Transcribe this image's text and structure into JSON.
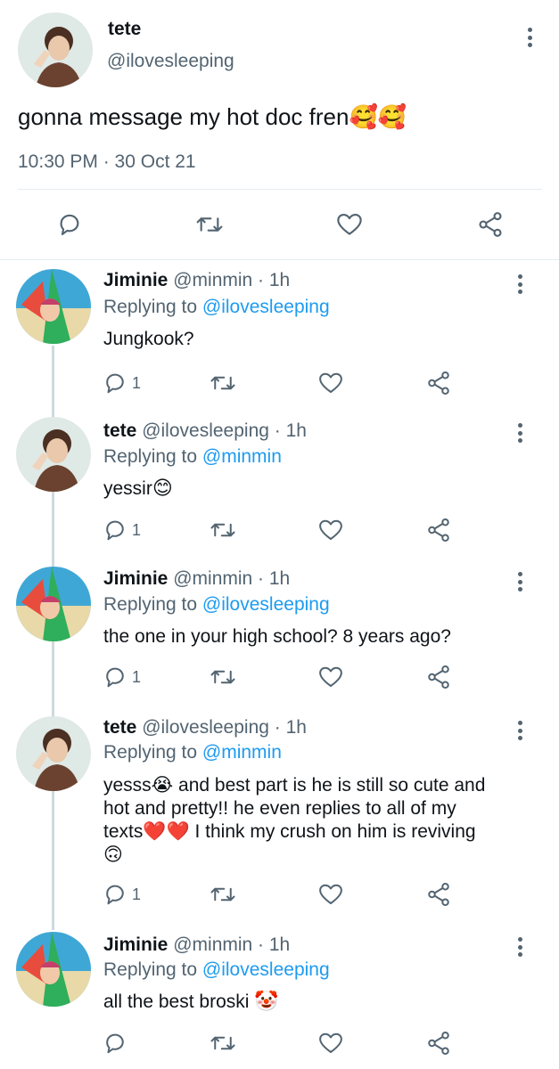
{
  "main_tweet": {
    "display_name": "tete",
    "handle": "@ilovesleeping",
    "text": "gonna message my hot doc fren",
    "text_emoji": "🥰🥰",
    "timestamp": "10:30 PM · 30 Oct 21"
  },
  "replies": [
    {
      "display_name": "Jiminie",
      "meta": "@minmin · 1h",
      "replying_label": "Replying to",
      "replying_handle": "@ilovesleeping",
      "text": "Jungkook?",
      "reply_count": "1"
    },
    {
      "display_name": "tete",
      "meta": "@ilovesleeping · 1h",
      "replying_label": "Replying to",
      "replying_handle": "@minmin",
      "text": "yessir",
      "text_emoji": "😊",
      "reply_count": "1"
    },
    {
      "display_name": "Jiminie",
      "meta": "@minmin · 1h",
      "replying_label": "Replying to",
      "replying_handle": "@ilovesleeping",
      "text": "the one in your high school? 8 years ago?",
      "reply_count": "1"
    },
    {
      "display_name": "tete",
      "meta": "@ilovesleeping · 1h",
      "replying_label": "Replying to",
      "replying_handle": "@minmin",
      "text_lines": [
        "yesss😭 and best part is he is still so cute and",
        "hot and pretty!! he even replies to all of my",
        "texts❤️❤️ I think my crush on him is reviving",
        "🙃"
      ],
      "reply_count": "1"
    },
    {
      "display_name": "Jiminie",
      "meta": "@minmin · 1h",
      "replying_label": "Replying to",
      "replying_handle": "@ilovesleeping",
      "text": "all the best broski",
      "text_emoji": "🤡",
      "reply_count": ""
    }
  ],
  "icons": {
    "reply": "reply-icon",
    "retweet": "retweet-icon",
    "like": "heart-icon",
    "share": "share-icon",
    "more": "more-options-icon"
  },
  "colors": {
    "text": "#0f1419",
    "muted": "#536471",
    "link": "#1d9bf0",
    "divider": "#e6ecf0"
  }
}
